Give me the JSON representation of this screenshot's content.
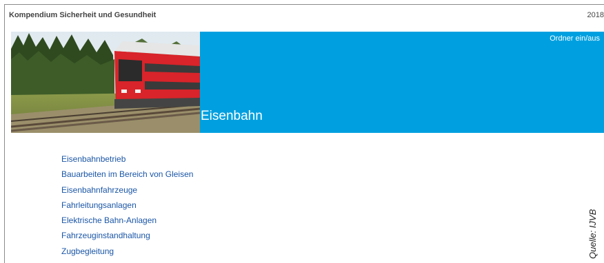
{
  "header": {
    "title": "Kompendium Sicherheit und Gesundheit",
    "year": "2018"
  },
  "hero": {
    "folder_toggle": "Ordner ein/aus",
    "title": "Eisenbahn",
    "band_color": "#00a0e0"
  },
  "links": [
    "Eisenbahnbetrieb",
    "Bauarbeiten im Bereich von Gleisen",
    "Eisenbahnfahrzeuge",
    "Fahrleitungsanlagen",
    "Elektrische Bahn-Anlagen",
    "Fahrzeuginstandhaltung",
    "Zugbegleitung"
  ],
  "source_credit": "Quelle: IJVB"
}
